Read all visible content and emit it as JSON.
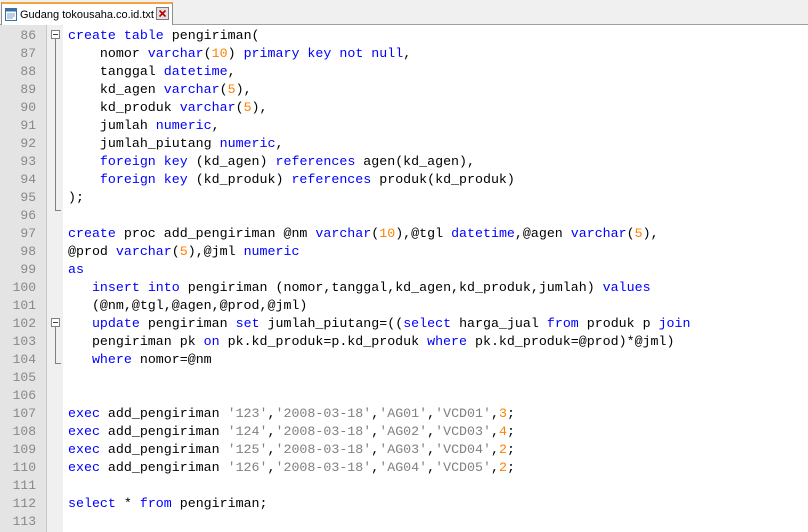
{
  "tab": {
    "title": "Gudang tokousaha.co.id.txt",
    "icon": "text-file-icon",
    "close_icon": "close-icon"
  },
  "colors": {
    "keyword": "#0000ff",
    "number": "#ff8000",
    "string": "#808080",
    "gutter": "#e4e4e4",
    "tab_accent": "#f5a33a"
  },
  "lines": [
    {
      "n": "86",
      "tokens": [
        [
          "kw",
          "create"
        ],
        [
          "t",
          " "
        ],
        [
          "kw",
          "table"
        ],
        [
          "t",
          " pengiriman("
        ]
      ]
    },
    {
      "n": "87",
      "tokens": [
        [
          "t",
          "    nomor "
        ],
        [
          "kw",
          "varchar"
        ],
        [
          "t",
          "("
        ],
        [
          "num",
          "10"
        ],
        [
          "t",
          ") "
        ],
        [
          "kw",
          "primary"
        ],
        [
          "t",
          " "
        ],
        [
          "kw",
          "key"
        ],
        [
          "t",
          " "
        ],
        [
          "kw",
          "not"
        ],
        [
          "t",
          " "
        ],
        [
          "kw",
          "null"
        ],
        [
          "t",
          ","
        ]
      ]
    },
    {
      "n": "88",
      "tokens": [
        [
          "t",
          "    tanggal "
        ],
        [
          "kw",
          "datetime"
        ],
        [
          "t",
          ","
        ]
      ]
    },
    {
      "n": "89",
      "tokens": [
        [
          "t",
          "    kd_agen "
        ],
        [
          "kw",
          "varchar"
        ],
        [
          "t",
          "("
        ],
        [
          "num",
          "5"
        ],
        [
          "t",
          "),"
        ]
      ]
    },
    {
      "n": "90",
      "tokens": [
        [
          "t",
          "    kd_produk "
        ],
        [
          "kw",
          "varchar"
        ],
        [
          "t",
          "("
        ],
        [
          "num",
          "5"
        ],
        [
          "t",
          "),"
        ]
      ]
    },
    {
      "n": "91",
      "tokens": [
        [
          "t",
          "    jumlah "
        ],
        [
          "kw",
          "numeric"
        ],
        [
          "t",
          ","
        ]
      ]
    },
    {
      "n": "92",
      "tokens": [
        [
          "t",
          "    jumlah_piutang "
        ],
        [
          "kw",
          "numeric"
        ],
        [
          "t",
          ","
        ]
      ]
    },
    {
      "n": "93",
      "tokens": [
        [
          "t",
          "    "
        ],
        [
          "kw",
          "foreign"
        ],
        [
          "t",
          " "
        ],
        [
          "kw",
          "key"
        ],
        [
          "t",
          " (kd_agen) "
        ],
        [
          "kw",
          "references"
        ],
        [
          "t",
          " agen(kd_agen),"
        ]
      ]
    },
    {
      "n": "94",
      "tokens": [
        [
          "t",
          "    "
        ],
        [
          "kw",
          "foreign"
        ],
        [
          "t",
          " "
        ],
        [
          "kw",
          "key"
        ],
        [
          "t",
          " (kd_produk) "
        ],
        [
          "kw",
          "references"
        ],
        [
          "t",
          " produk(kd_produk)"
        ]
      ]
    },
    {
      "n": "95",
      "tokens": [
        [
          "t",
          ");"
        ]
      ]
    },
    {
      "n": "96",
      "tokens": []
    },
    {
      "n": "97",
      "tokens": [
        [
          "kw",
          "create"
        ],
        [
          "t",
          " proc add_pengiriman @nm "
        ],
        [
          "kw",
          "varchar"
        ],
        [
          "t",
          "("
        ],
        [
          "num",
          "10"
        ],
        [
          "t",
          "),@tgl "
        ],
        [
          "kw",
          "datetime"
        ],
        [
          "t",
          ",@agen "
        ],
        [
          "kw",
          "varchar"
        ],
        [
          "t",
          "("
        ],
        [
          "num",
          "5"
        ],
        [
          "t",
          "),"
        ]
      ]
    },
    {
      "n": "98",
      "tokens": [
        [
          "t",
          "@prod "
        ],
        [
          "kw",
          "varchar"
        ],
        [
          "t",
          "("
        ],
        [
          "num",
          "5"
        ],
        [
          "t",
          "),@jml "
        ],
        [
          "kw",
          "numeric"
        ]
      ]
    },
    {
      "n": "99",
      "tokens": [
        [
          "kw",
          "as"
        ]
      ]
    },
    {
      "n": "100",
      "tokens": [
        [
          "t",
          "   "
        ],
        [
          "kw",
          "insert"
        ],
        [
          "t",
          " "
        ],
        [
          "kw",
          "into"
        ],
        [
          "t",
          " pengiriman (nomor,tanggal,kd_agen,kd_produk,jumlah) "
        ],
        [
          "kw",
          "values"
        ]
      ]
    },
    {
      "n": "101",
      "tokens": [
        [
          "t",
          "   (@nm,@tgl,@agen,@prod,@jml)"
        ]
      ]
    },
    {
      "n": "102",
      "tokens": [
        [
          "t",
          "   "
        ],
        [
          "kw",
          "update"
        ],
        [
          "t",
          " pengiriman "
        ],
        [
          "kw",
          "set"
        ],
        [
          "t",
          " jumlah_piutang=(("
        ],
        [
          "kw",
          "select"
        ],
        [
          "t",
          " harga_jual "
        ],
        [
          "kw",
          "from"
        ],
        [
          "t",
          " produk p "
        ],
        [
          "kw",
          "join"
        ]
      ]
    },
    {
      "n": "103",
      "tokens": [
        [
          "t",
          "   pengiriman pk "
        ],
        [
          "kw",
          "on"
        ],
        [
          "t",
          " pk.kd_produk=p.kd_produk "
        ],
        [
          "kw",
          "where"
        ],
        [
          "t",
          " pk.kd_produk=@prod)*@jml)"
        ]
      ]
    },
    {
      "n": "104",
      "tokens": [
        [
          "t",
          "   "
        ],
        [
          "kw",
          "where"
        ],
        [
          "t",
          " nomor=@nm"
        ]
      ]
    },
    {
      "n": "105",
      "tokens": []
    },
    {
      "n": "106",
      "tokens": []
    },
    {
      "n": "107",
      "tokens": [
        [
          "kw",
          "exec"
        ],
        [
          "t",
          " add_pengiriman "
        ],
        [
          "str",
          "'123'"
        ],
        [
          "t",
          ","
        ],
        [
          "str",
          "'2008-03-18'"
        ],
        [
          "t",
          ","
        ],
        [
          "str",
          "'AG01'"
        ],
        [
          "t",
          ","
        ],
        [
          "str",
          "'VCD01'"
        ],
        [
          "t",
          ","
        ],
        [
          "num",
          "3"
        ],
        [
          "t",
          ";"
        ]
      ]
    },
    {
      "n": "108",
      "tokens": [
        [
          "kw",
          "exec"
        ],
        [
          "t",
          " add_pengiriman "
        ],
        [
          "str",
          "'124'"
        ],
        [
          "t",
          ","
        ],
        [
          "str",
          "'2008-03-18'"
        ],
        [
          "t",
          ","
        ],
        [
          "str",
          "'AG02'"
        ],
        [
          "t",
          ","
        ],
        [
          "str",
          "'VCD03'"
        ],
        [
          "t",
          ","
        ],
        [
          "num",
          "4"
        ],
        [
          "t",
          ";"
        ]
      ]
    },
    {
      "n": "109",
      "tokens": [
        [
          "kw",
          "exec"
        ],
        [
          "t",
          " add_pengiriman "
        ],
        [
          "str",
          "'125'"
        ],
        [
          "t",
          ","
        ],
        [
          "str",
          "'2008-03-18'"
        ],
        [
          "t",
          ","
        ],
        [
          "str",
          "'AG03'"
        ],
        [
          "t",
          ","
        ],
        [
          "str",
          "'VCD04'"
        ],
        [
          "t",
          ","
        ],
        [
          "num",
          "2"
        ],
        [
          "t",
          ";"
        ]
      ]
    },
    {
      "n": "110",
      "tokens": [
        [
          "kw",
          "exec"
        ],
        [
          "t",
          " add_pengiriman "
        ],
        [
          "str",
          "'126'"
        ],
        [
          "t",
          ","
        ],
        [
          "str",
          "'2008-03-18'"
        ],
        [
          "t",
          ","
        ],
        [
          "str",
          "'AG04'"
        ],
        [
          "t",
          ","
        ],
        [
          "str",
          "'VCD05'"
        ],
        [
          "t",
          ","
        ],
        [
          "num",
          "2"
        ],
        [
          "t",
          ";"
        ]
      ]
    },
    {
      "n": "111",
      "tokens": []
    },
    {
      "n": "112",
      "tokens": [
        [
          "kw",
          "select"
        ],
        [
          "t",
          " * "
        ],
        [
          "kw",
          "from"
        ],
        [
          "t",
          " pengiriman;"
        ]
      ]
    },
    {
      "n": "113",
      "tokens": []
    }
  ]
}
